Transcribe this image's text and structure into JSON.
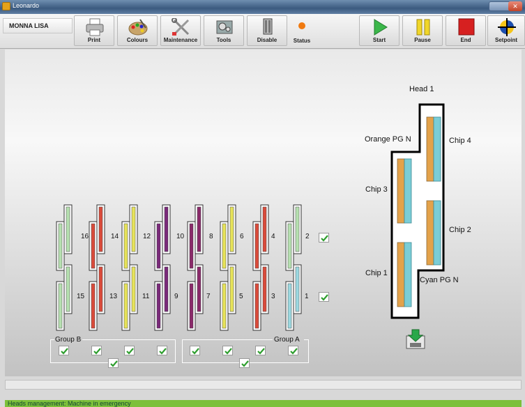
{
  "window": {
    "title": "Leonardo"
  },
  "toolbar": {
    "user": "MONNA LISA",
    "buttons": {
      "print": "Print",
      "colours": "Colours",
      "maintenance": "Maintenance",
      "tools": "Tools",
      "disable": "Disable",
      "status": "Status",
      "start": "Start",
      "pause": "Pause",
      "end": "End",
      "setpoint": "Setpoint"
    }
  },
  "heads": {
    "top_row": [
      "16",
      "14",
      "12",
      "10",
      "8",
      "6",
      "4",
      "2"
    ],
    "bottom_row": [
      "15",
      "13",
      "11",
      "9",
      "7",
      "5",
      "3",
      "1"
    ],
    "group_b_label": "Group B",
    "group_a_label": "Group A"
  },
  "head_detail": {
    "title": "Head 1",
    "orange_label": "Orange PG N",
    "cyan_label": "Cyan PG N",
    "chips": [
      "Chip 1",
      "Chip 2",
      "Chip 3",
      "Chip 4"
    ]
  },
  "status": {
    "message": "Heads management: Machine in emergency"
  },
  "colors": {
    "status_bar": "#7cc03a",
    "check": "#2e9e2e",
    "orange": "#e3a24a",
    "cyan": "#7bcdd6"
  }
}
